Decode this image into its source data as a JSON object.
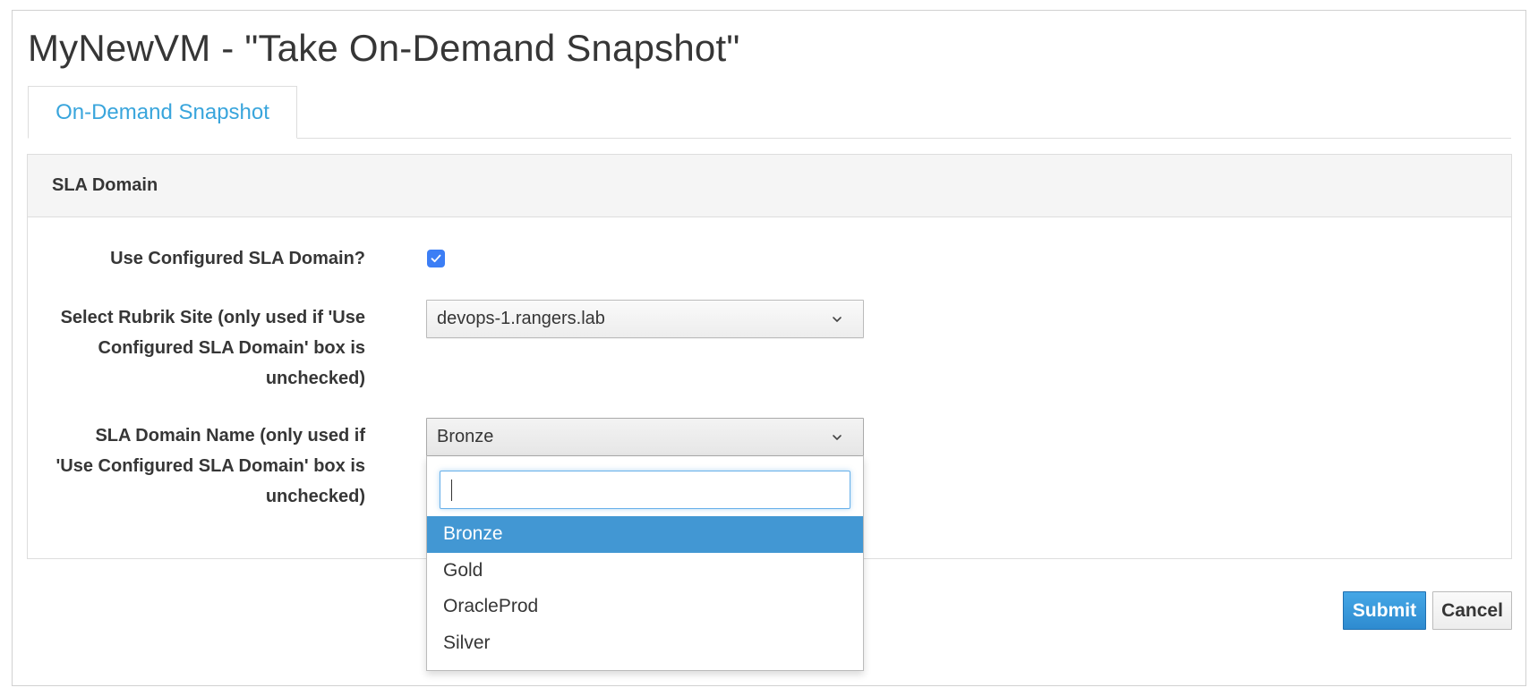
{
  "header": {
    "title": "MyNewVM - \"Take On-Demand Snapshot\""
  },
  "tabs": [
    {
      "label": "On-Demand Snapshot",
      "active": true
    }
  ],
  "panel": {
    "heading": "SLA Domain"
  },
  "form": {
    "use_configured": {
      "label": "Use Configured SLA Domain?",
      "checked": true
    },
    "rubrik_site": {
      "label_lines": [
        "Select Rubrik Site (only used if 'Use",
        "Configured SLA Domain' box is",
        "unchecked)"
      ],
      "value": "devops-1.rangers.lab"
    },
    "sla_domain_name": {
      "label_lines": [
        "SLA Domain Name (only used if",
        "'Use Configured SLA Domain' box is",
        "unchecked)"
      ],
      "value": "Bronze",
      "search_value": "",
      "options": [
        "Bronze",
        "Gold",
        "OracleProd",
        "Silver"
      ],
      "selected_option": "Bronze"
    }
  },
  "actions": {
    "submit_label": "Submit",
    "cancel_label": "Cancel"
  },
  "colors": {
    "accent": "#39a5dc",
    "checkbox": "#3c7ef5",
    "selected_option": "#4297d3",
    "submit_button": "#2e8bd0"
  },
  "icons": {
    "checkbox": "checkmark-icon",
    "select": "chevron-down-icon"
  }
}
